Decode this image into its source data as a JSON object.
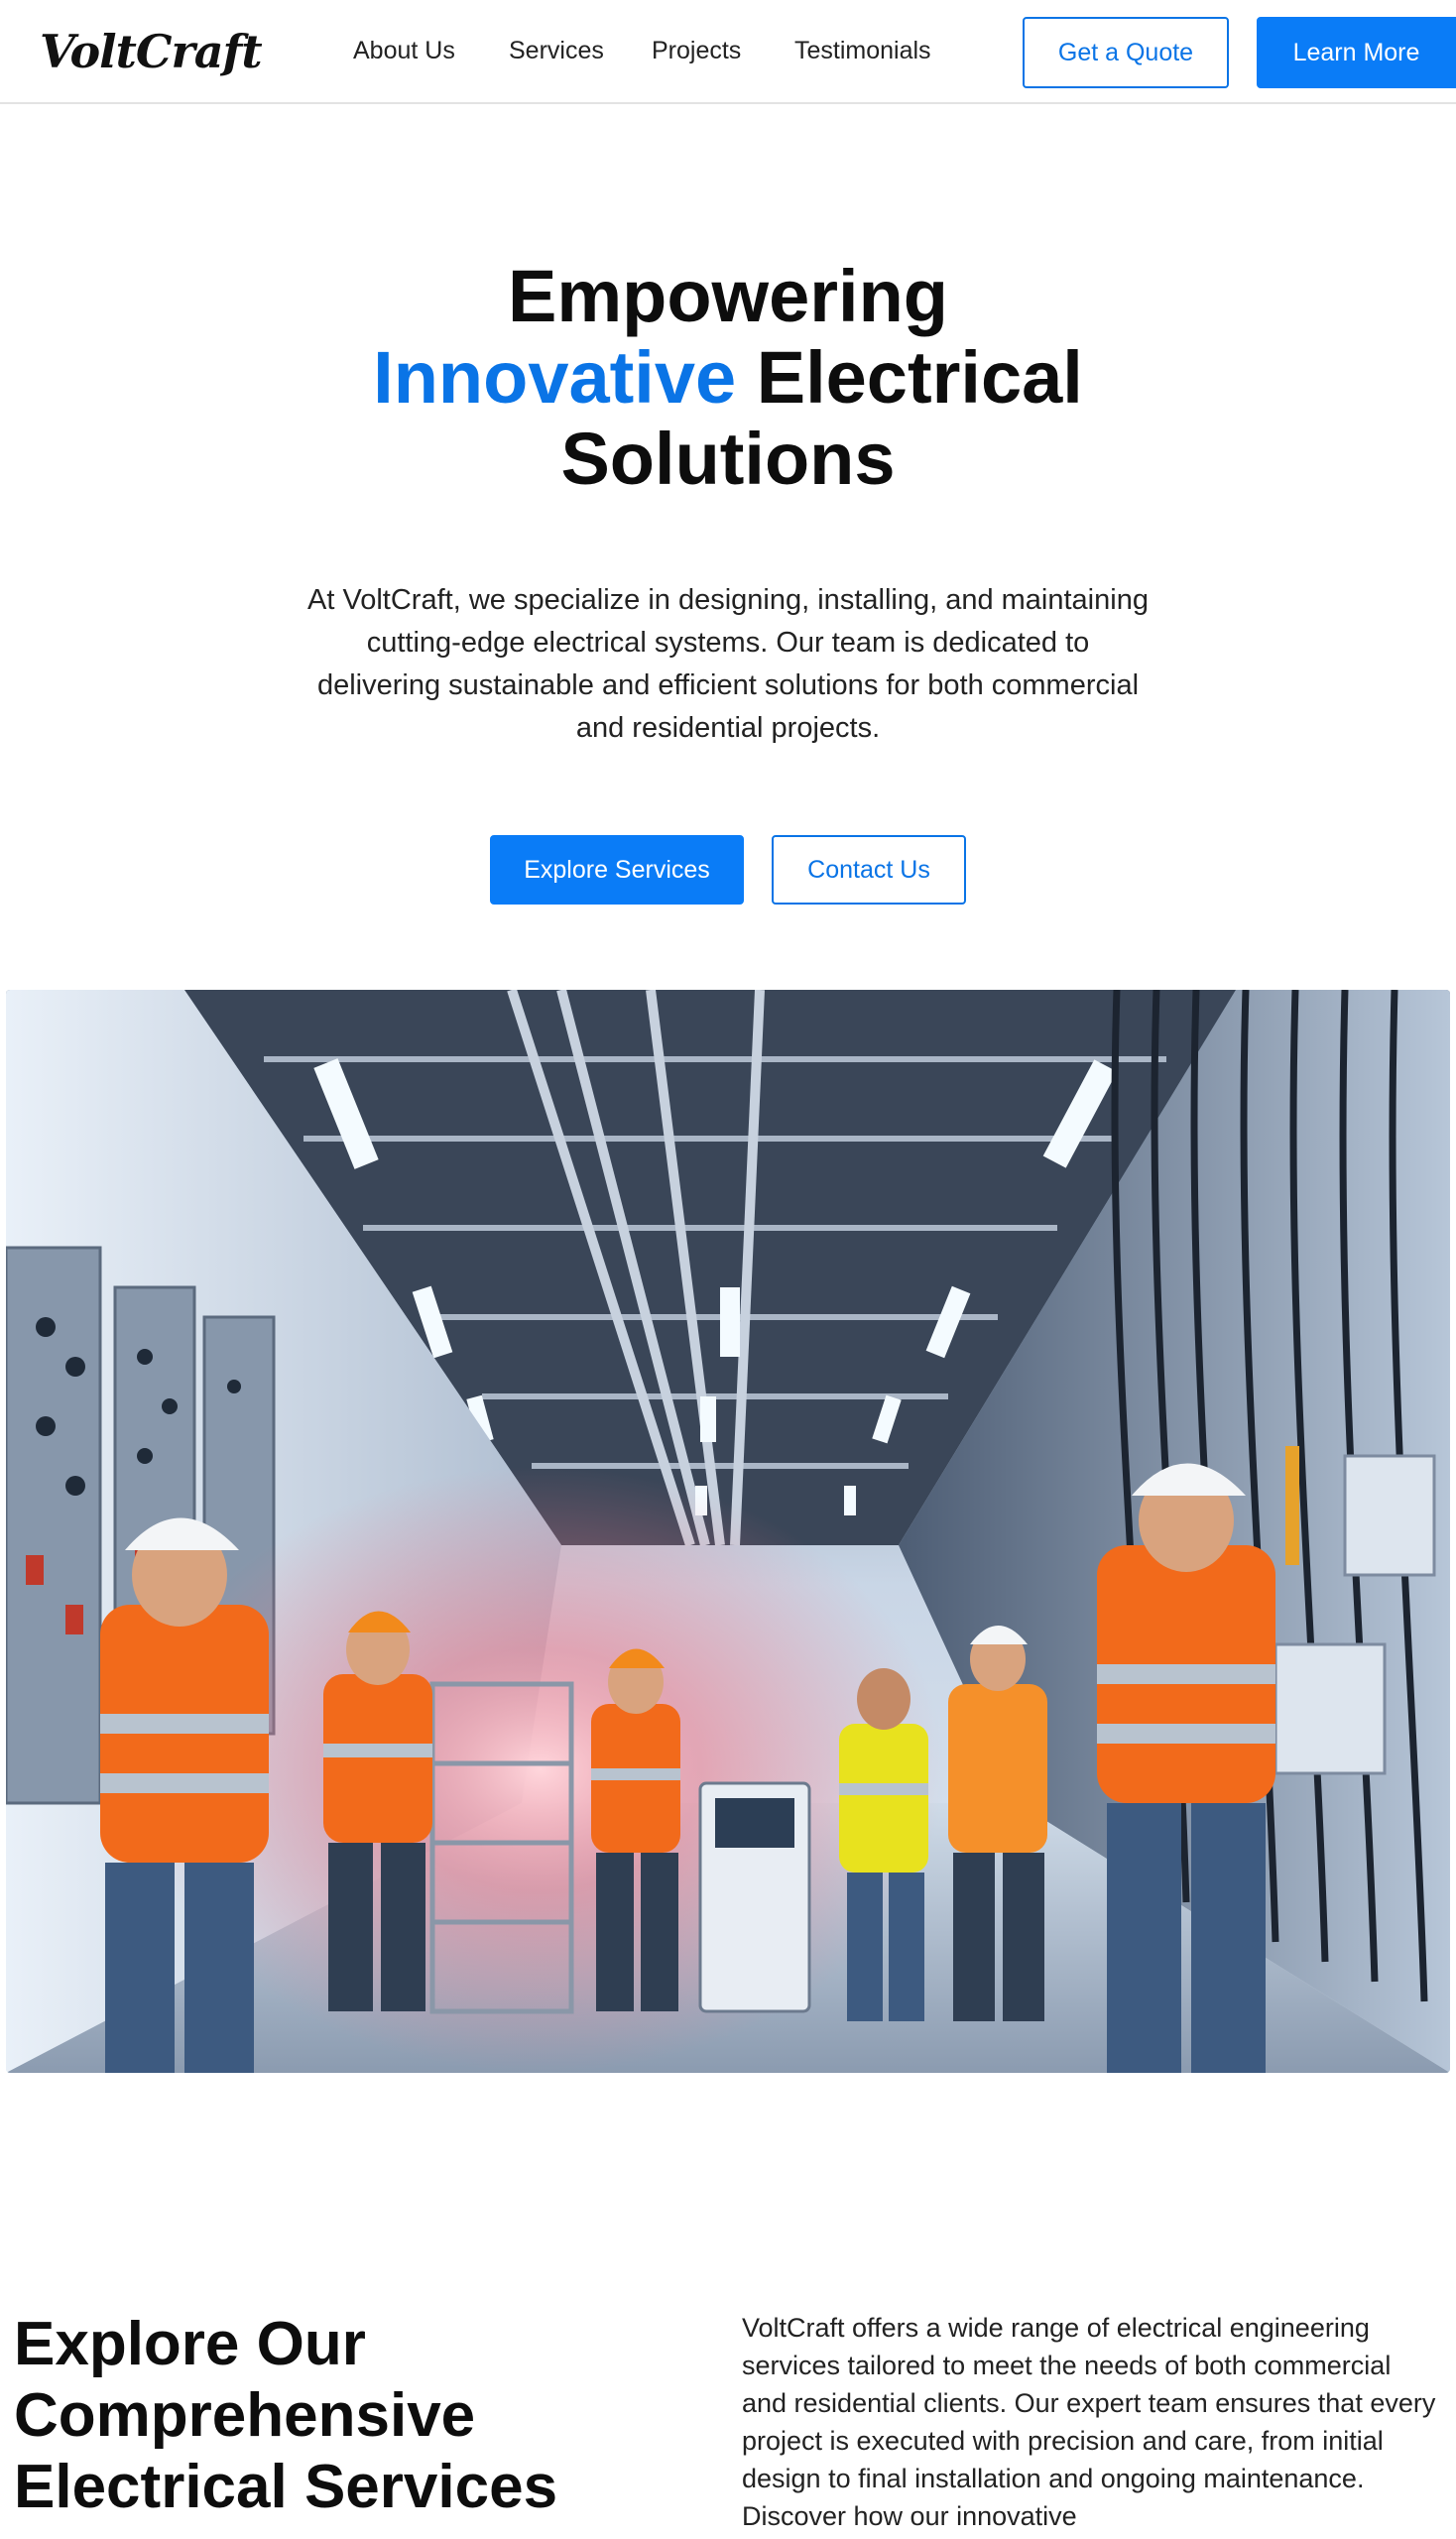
{
  "header": {
    "logo": "VoltCraft",
    "nav": [
      "About Us",
      "Services",
      "Projects",
      "Testimonials"
    ],
    "quote_button": "Get a Quote",
    "learn_button": "Learn More"
  },
  "hero": {
    "title_line1": "Empowering",
    "title_accent": "Innovative",
    "title_line2_rest": " Electrical",
    "title_line3": "Solutions",
    "description": "At VoltCraft, we specialize in designing, installing, and maintaining cutting-edge electrical systems. Our team is dedicated to delivering sustainable and efficient solutions for both commercial and residential projects.",
    "primary_button": "Explore Services",
    "secondary_button": "Contact Us"
  },
  "services": {
    "title": "Explore Our Comprehensive Electrical Services",
    "description": "VoltCraft offers a wide range of electrical engineering services tailored to meet the needs of both commercial and residential clients. Our expert team ensures that every project is executed with precision and care, from initial design to final installation and ongoing maintenance. Discover how our innovative"
  },
  "colors": {
    "accent": "#0a74e6",
    "button_primary": "#0a7cf7"
  }
}
